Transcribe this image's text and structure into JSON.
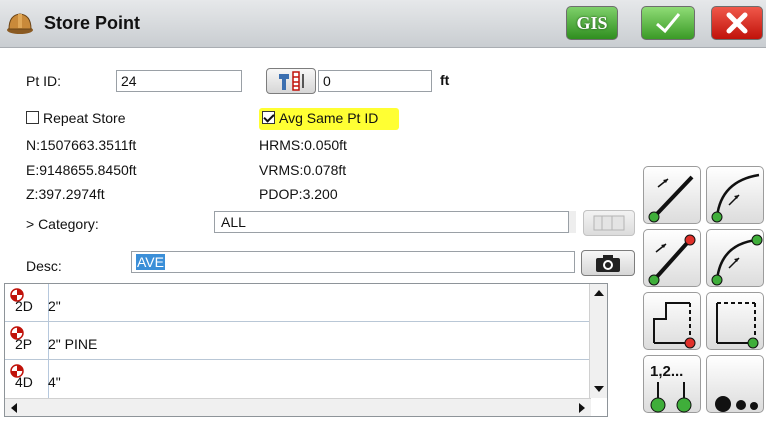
{
  "window": {
    "title": "Store Point",
    "gis_label": "GIS"
  },
  "form": {
    "pt_id_label": "Pt ID:",
    "pt_id_value": "24",
    "rod_height_value": "0",
    "rod_unit": "ft",
    "repeat_store_label": "Repeat Store",
    "repeat_store_checked": false,
    "avg_same_label": "Avg Same Pt ID",
    "avg_same_checked": true,
    "northing": "N:1507663.3511ft",
    "easting": "E:9148655.8450ft",
    "elevation": "Z:397.2974ft",
    "hrms": "HRMS:0.050ft",
    "vrms": "VRMS:0.078ft",
    "pdop": "PDOP:3.200",
    "category_label": "> Category:",
    "category_value": "ALL",
    "desc_label": "Desc:",
    "desc_value": "AVE"
  },
  "list": {
    "rows": [
      {
        "code": "2D",
        "desc": "2\""
      },
      {
        "code": "2P",
        "desc": "2\" PINE"
      },
      {
        "code": "4D",
        "desc": "4\""
      }
    ]
  },
  "tools": {
    "sequence_label": "1,2..."
  },
  "colors": {
    "accent_green": "#3a9a26",
    "close_red": "#c0120a",
    "highlight_yellow": "#ffff33",
    "point_green": "#3fae3a",
    "point_red": "#e0302a"
  }
}
